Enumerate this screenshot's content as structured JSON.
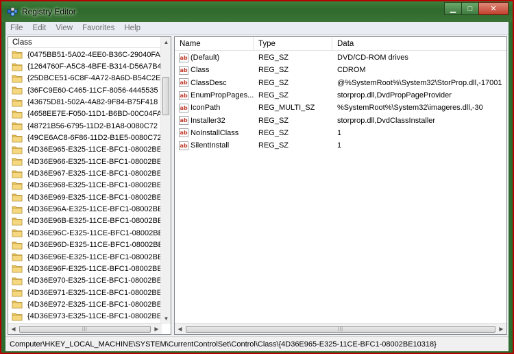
{
  "window": {
    "title": "Registry Editor",
    "controls": {
      "minimize": "▁",
      "maximize": "□",
      "close": "✕"
    }
  },
  "menu": [
    "File",
    "Edit",
    "View",
    "Favorites",
    "Help"
  ],
  "tree": {
    "header": "Class",
    "items": [
      "{0475BB51-5A02-4EE0-B36C-29040FA",
      "{1264760F-A5C8-4BFE-B314-D56A7B4",
      "{25DBCE51-6C8F-4A72-8A6D-B54C2E",
      "{36FC9E60-C465-11CF-8056-4445535",
      "{43675D81-502A-4A82-9F84-B75F418",
      "{4658EE7E-F050-11D1-B6BD-00C04FA",
      "{48721B56-6795-11D2-B1A8-0080C72",
      "{49CE6AC8-6F86-11D2-B1E5-0080C72",
      "{4D36E965-E325-11CE-BFC1-08002BE",
      "{4D36E966-E325-11CE-BFC1-08002BE",
      "{4D36E967-E325-11CE-BFC1-08002BE",
      "{4D36E968-E325-11CE-BFC1-08002BE",
      "{4D36E969-E325-11CE-BFC1-08002BE",
      "{4D36E96A-E325-11CE-BFC1-08002BE",
      "{4D36E96B-E325-11CE-BFC1-08002BE",
      "{4D36E96C-E325-11CE-BFC1-08002BE",
      "{4D36E96D-E325-11CE-BFC1-08002BE",
      "{4D36E96E-E325-11CE-BFC1-08002BE",
      "{4D36E96F-E325-11CE-BFC1-08002BE",
      "{4D36E970-E325-11CE-BFC1-08002BE",
      "{4D36E971-E325-11CE-BFC1-08002BE",
      "{4D36E972-E325-11CE-BFC1-08002BE",
      "{4D36E973-E325-11CE-BFC1-08002BE"
    ]
  },
  "list": {
    "columns": [
      "Name",
      "Type",
      "Data"
    ],
    "rows": [
      {
        "name": "(Default)",
        "type": "REG_SZ",
        "data": "DVD/CD-ROM drives"
      },
      {
        "name": "Class",
        "type": "REG_SZ",
        "data": "CDROM"
      },
      {
        "name": "ClassDesc",
        "type": "REG_SZ",
        "data": "@%SystemRoot%\\System32\\StorProp.dll,-17001"
      },
      {
        "name": "EnumPropPages...",
        "type": "REG_SZ",
        "data": "storprop.dll,DvdPropPageProvider"
      },
      {
        "name": "IconPath",
        "type": "REG_MULTI_SZ",
        "data": "%SystemRoot%\\System32\\imageres.dll,-30"
      },
      {
        "name": "Installer32",
        "type": "REG_SZ",
        "data": "storprop.dll,DvdClassInstaller"
      },
      {
        "name": "NoInstallClass",
        "type": "REG_SZ",
        "data": "1"
      },
      {
        "name": "SilentInstall",
        "type": "REG_SZ",
        "data": "1"
      }
    ]
  },
  "icons": {
    "value": "ab-string-value-icon",
    "folder": "folder-icon"
  },
  "status": "Computer\\HKEY_LOCAL_MACHINE\\SYSTEM\\CurrentControlSet\\Control\\Class\\{4D36E965-E325-11CE-BFC1-08002BE10318}"
}
